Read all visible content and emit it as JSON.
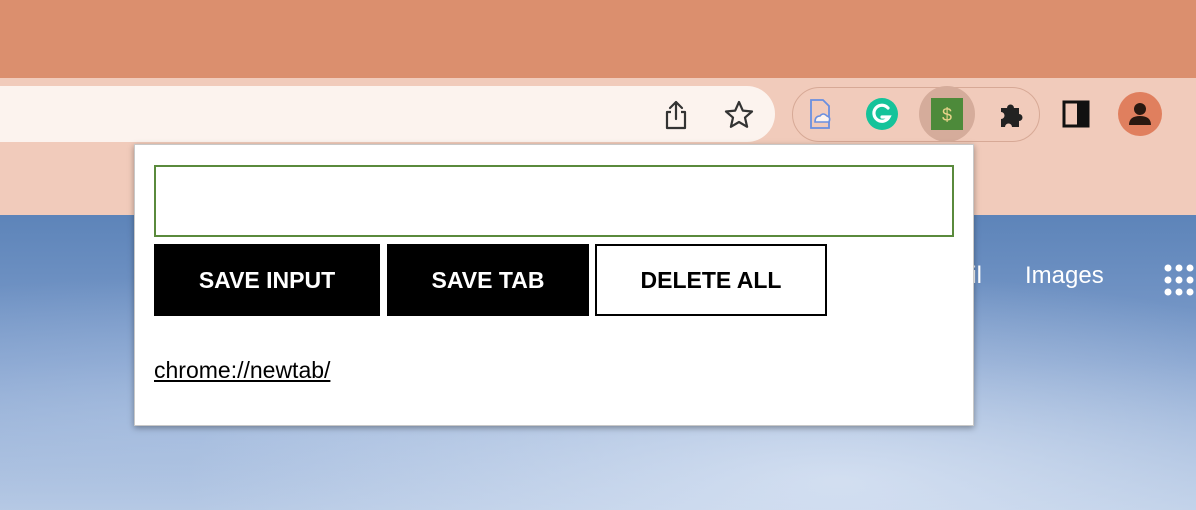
{
  "browser": {
    "toolbar_icons": [
      "share-icon",
      "star-icon"
    ],
    "extensions": [
      "docs-offline-icon",
      "grammarly-icon",
      "money-extension-icon",
      "puzzle-icon"
    ],
    "sidepanel_icon": "sidepanel-icon",
    "avatar_icon": "person-icon",
    "colors": {
      "tabstrip": "#db8f6e",
      "toolbar": "#f1cbbb",
      "grammarly": "#15c39a",
      "money_ext": "#4d8a3a"
    }
  },
  "page": {
    "gmail_label": "ail",
    "images_label": "Images",
    "apps_icon": "apps-grid-icon"
  },
  "popup": {
    "input_value": "",
    "save_input_label": "SAVE INPUT",
    "save_tab_label": "SAVE TAB",
    "delete_all_label": "DELETE ALL",
    "saved_items": [
      "chrome://newtab/"
    ]
  }
}
